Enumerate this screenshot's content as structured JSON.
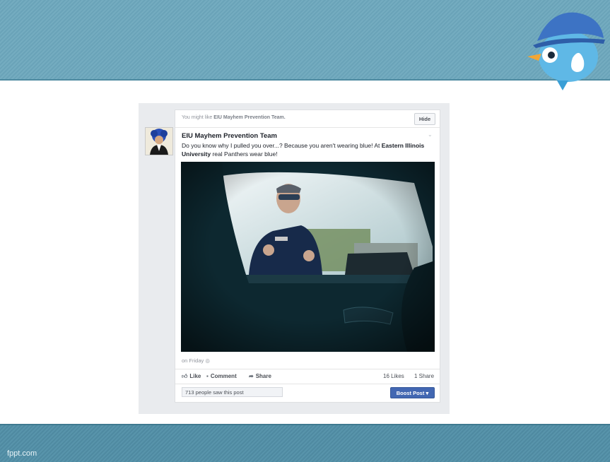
{
  "slide": {
    "footer_brand": "fppt.com"
  },
  "post": {
    "suggestion_prefix": "You might like ",
    "suggestion_page": "EIU Mayhem Prevention Team.",
    "hide_label": "Hide",
    "page_name": "EIU Mayhem Prevention Team",
    "text_part1": "Do you know why I pulled you over...? Because you aren't wearing blue! At ",
    "text_link": "Eastern Illinois University",
    "text_part2": " real Panthers wear blue!",
    "timestamp": "on Friday",
    "actions": {
      "like": "Like",
      "comment": "Comment",
      "share": "Share"
    },
    "likes_count": "16 Likes",
    "shares_count": "1 Share",
    "reach_text": "713 people saw this post",
    "boost_label": "Boost Post",
    "boost_color": "#4267b2"
  },
  "icons": [
    "like-icon",
    "comment-icon",
    "share-icon",
    "globe-icon",
    "chevron-down-icon",
    "mascot-icon"
  ]
}
